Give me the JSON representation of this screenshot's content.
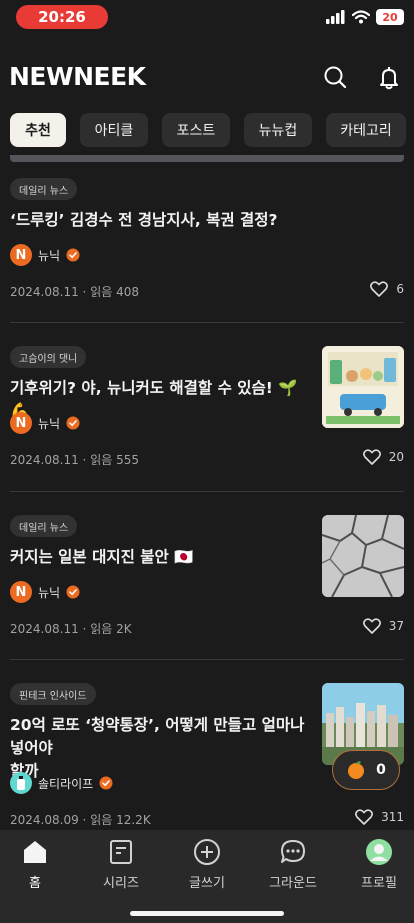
{
  "status_bar": {
    "time": "20:26",
    "battery": "20"
  },
  "header": {
    "logo": "NEWNEEK"
  },
  "tabs": [
    {
      "label": "추천",
      "active": true
    },
    {
      "label": "아티클",
      "active": false
    },
    {
      "label": "포스트",
      "active": false
    },
    {
      "label": "뉴뉴컵",
      "active": false
    },
    {
      "label": "카테고리",
      "active": false
    }
  ],
  "articles": [
    {
      "category": "데일리 뉴스",
      "title": "‘드루킹’ 김경수 전 경남지사, 복권 결정?",
      "author": "뉴닉",
      "date": "2024.08.11",
      "reads": "읽음 408",
      "likes": "6"
    },
    {
      "category": "고슴이의 댓니",
      "title": "기후위기? 야, 뉴니커도 해결할 수 있슴! 🌱💪",
      "author": "뉴닉",
      "date": "2024.08.11",
      "reads": "읽음 555",
      "likes": "20"
    },
    {
      "category": "데일리 뉴스",
      "title": "커지는 일본 대지진 불안 🇯🇵",
      "author": "뉴닉",
      "date": "2024.08.11",
      "reads": "읽음 2K",
      "likes": "37"
    },
    {
      "category": "핀테크 인사이드",
      "title_line1": "20억 로또 ‘청약통장’, 어떻게 만들고 얼마나 넣어야",
      "title_line2": "할까",
      "author": "솔티라이프",
      "date": "2024.08.09",
      "reads": "읽음 12.2K",
      "likes": "311"
    }
  ],
  "meta_separator": "·",
  "coin": {
    "icon": "tangerine-icon",
    "count": "0"
  },
  "bottom_nav": [
    {
      "label": "홈",
      "icon": "home-icon"
    },
    {
      "label": "시리즈",
      "icon": "series-icon"
    },
    {
      "label": "글쓰기",
      "icon": "plus-circle-icon"
    },
    {
      "label": "그라운드",
      "icon": "chat-bubble-icon"
    },
    {
      "label": "프로필",
      "icon": "profile-avatar-icon"
    }
  ],
  "colors": {
    "background": "#1c1b1b",
    "status_pill": "#e83b36",
    "brand_orange": "#ec6b22",
    "active_tab": "#f4f1ea"
  }
}
